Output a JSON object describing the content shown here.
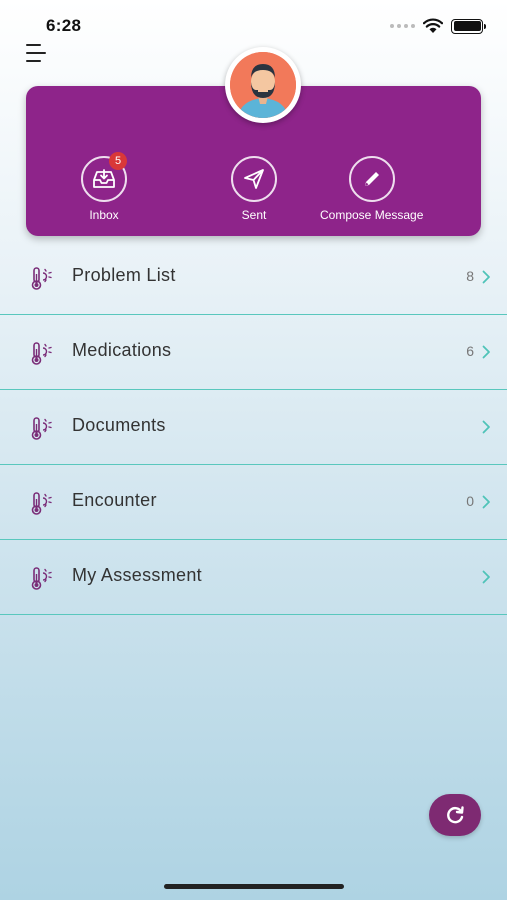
{
  "status_bar": {
    "time": "6:28"
  },
  "header": {
    "actions": [
      {
        "label": "Inbox",
        "icon": "inbox-icon",
        "badge": "5"
      },
      {
        "label": "Sent",
        "icon": "send-icon"
      },
      {
        "label": "Compose Message",
        "icon": "pencil-icon"
      }
    ]
  },
  "list": {
    "items": [
      {
        "label": "Problem List",
        "count": "8"
      },
      {
        "label": "Medications",
        "count": "6"
      },
      {
        "label": "Documents",
        "count": ""
      },
      {
        "label": "Encounter",
        "count": "0"
      },
      {
        "label": "My Assessment",
        "count": ""
      }
    ]
  },
  "colors": {
    "accent": "#8e248a",
    "divider": "#59c7bd",
    "badge": "#d93838",
    "refresh_button": "#7e2a72",
    "icon": "#7a2d78",
    "chevron": "#4fc3b8"
  }
}
